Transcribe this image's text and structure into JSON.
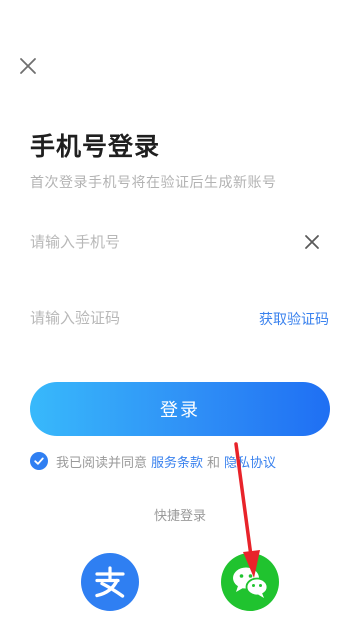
{
  "header": {
    "title": "手机号登录",
    "subtitle": "首次登录手机号将在验证后生成新账号"
  },
  "phone": {
    "placeholder": "请输入手机号",
    "value": ""
  },
  "code": {
    "placeholder": "请输入验证码",
    "value": "",
    "get_code_label": "获取验证码"
  },
  "login": {
    "label": "登录"
  },
  "agreement": {
    "checked": true,
    "prefix": "我已阅读并同意",
    "terms_label": "服务条款",
    "and": "和",
    "privacy_label": "隐私协议"
  },
  "quick_login": {
    "label": "快捷登录",
    "providers": [
      {
        "name": "alipay",
        "icon": "alipay-icon",
        "color": "#2f7ff2"
      },
      {
        "name": "wechat",
        "icon": "wechat-icon",
        "color": "#20c32f"
      }
    ]
  },
  "theme": {
    "accent": "#3a82ee",
    "annotation_arrow": "#e8232a"
  }
}
